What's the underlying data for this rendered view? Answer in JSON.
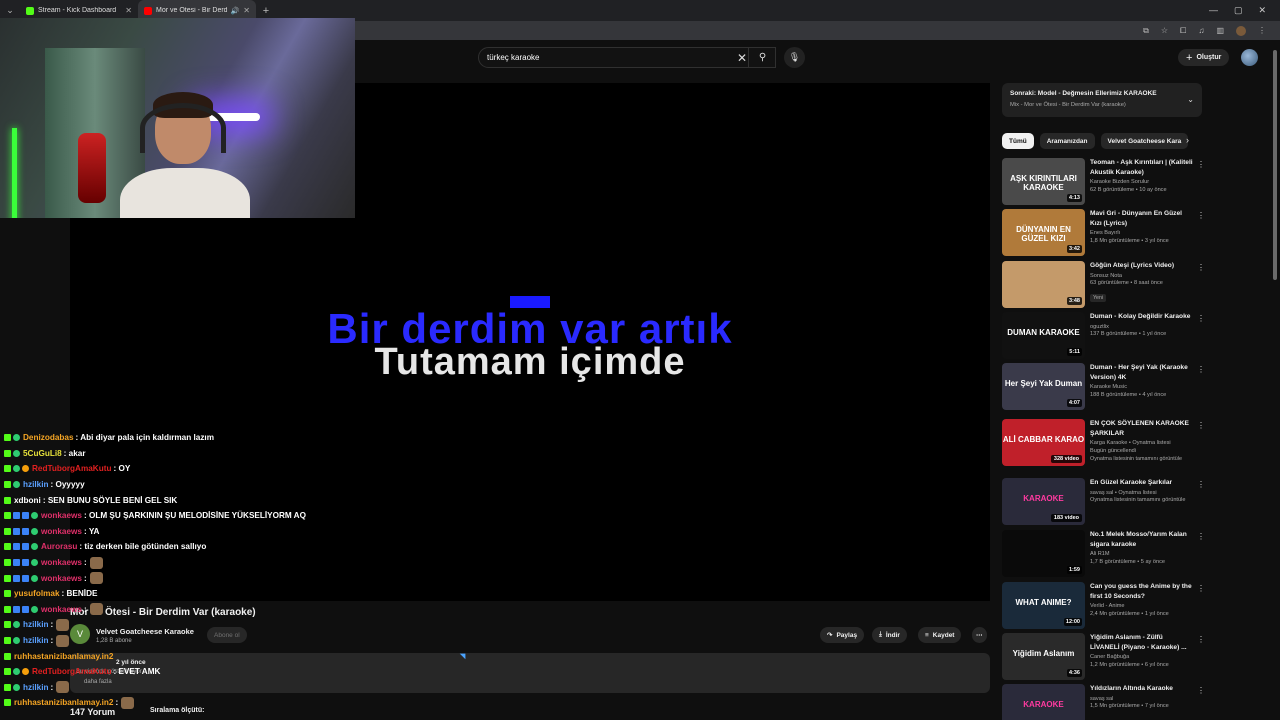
{
  "browser": {
    "tabs": [
      {
        "title": "Stream - Kick Dashboard",
        "active": false,
        "color": "#53fc18"
      },
      {
        "title": "Mor ve Ötesi - Bir Derdim V",
        "active": true,
        "color": "#ff0000"
      }
    ],
    "new_tab": "+"
  },
  "header": {
    "search_value": "türkeç karaoke",
    "create_label": "Oluştur"
  },
  "player": {
    "lyric_line1": "Bir derdim var artık",
    "lyric_line2": "Tutamam içimde"
  },
  "chat": [
    {
      "user": "Denizodabas",
      "user_color": "#f5a524",
      "badges": [
        "k",
        "g"
      ],
      "msg": ": Abi diyar pala için kaldırman lazım"
    },
    {
      "user": "5CuGuLi8",
      "user_color": "#e6e03a",
      "badges": [
        "k",
        "g"
      ],
      "msg": ": akar"
    },
    {
      "user": "RedTuborgAmaKutu",
      "user_color": "#e02020",
      "badges": [
        "k",
        "g",
        "y"
      ],
      "msg": ": OY"
    },
    {
      "user": "hzilkin",
      "user_color": "#5aa0ff",
      "badges": [
        "k",
        "g"
      ],
      "msg": ": Oyyyyy"
    },
    {
      "user": "xdboni",
      "user_color": "#ffffff",
      "badges": [
        "k"
      ],
      "msg": ": SEN BUNU SÖYLE BENİ GEL SIK"
    },
    {
      "user": "wonkaews",
      "user_color": "#e0306a",
      "badges": [
        "k",
        "c",
        "c",
        "g"
      ],
      "msg": ": OLM ŞU ŞARKININ ŞU MELODİSİNE YÜKSELİYORM AQ"
    },
    {
      "user": "wonkaews",
      "user_color": "#e0306a",
      "badges": [
        "k",
        "c",
        "c",
        "g"
      ],
      "msg": ": YA"
    },
    {
      "user": "Aurorasu",
      "user_color": "#e0306a",
      "badges": [
        "k",
        "c",
        "c",
        "g"
      ],
      "msg": ": tiz derken bile götünden sallıyo"
    },
    {
      "user": "wonkaews",
      "user_color": "#e0306a",
      "badges": [
        "k",
        "c",
        "c",
        "g"
      ],
      "msg": ":",
      "emote": true
    },
    {
      "user": "wonkaews",
      "user_color": "#e0306a",
      "badges": [
        "k",
        "c",
        "c",
        "g"
      ],
      "msg": ":",
      "emote": true
    },
    {
      "user": "yusufolmak",
      "user_color": "#f5a524",
      "badges": [
        "k"
      ],
      "msg": ": BENİDE"
    },
    {
      "user": "wonkaews",
      "user_color": "#e0306a",
      "badges": [
        "k",
        "c",
        "c",
        "g"
      ],
      "msg": ":",
      "emote": true
    },
    {
      "user": "hzilkin",
      "user_color": "#5aa0ff",
      "badges": [
        "k",
        "g"
      ],
      "msg": ":",
      "emote": true
    },
    {
      "user": "hzilkin",
      "user_color": "#5aa0ff",
      "badges": [
        "k",
        "g"
      ],
      "msg": ":",
      "emote": true
    },
    {
      "user": "ruhhastanizibanlamay.in2",
      "user_color": "#f5a524",
      "badges": [
        "k"
      ],
      "msg": ""
    },
    {
      "user": "RedTuborgAmaKutu",
      "user_color": "#e02020",
      "badges": [
        "k",
        "g",
        "y"
      ],
      "msg": ": EVET AMK"
    },
    {
      "user": "hzilkin",
      "user_color": "#5aa0ff",
      "badges": [
        "k",
        "g"
      ],
      "msg": ":",
      "emote": true
    },
    {
      "user": "ruhhastanizibanlamay.in2",
      "user_color": "#f5a524",
      "badges": [
        "k"
      ],
      "msg": ":",
      "emote": true
    }
  ],
  "video": {
    "title": "Mor ve Ötesi - Bir Derdim Var (karaoke)",
    "channel": "Velvet Goatcheese Karaoke",
    "channel_initial": "V",
    "subscribers": "1,28 B abone",
    "subscribe_label": "Abone ol",
    "share_label": "Paylaş",
    "download_label": "İndir",
    "save_label": "Kaydet",
    "views": "2 yıl önce",
    "desc1": "Bu videoda gösterilmiyor",
    "desc2": "daha fazla",
    "desc_note": "bulunmuyor değil",
    "comments_count": "147 Yorum",
    "sort_label": "Sıralama ölçütü:"
  },
  "sidebar": {
    "up_next_title": "Sonraki: Model - Değmesin Ellerimiz KARAOKE",
    "up_next_sub": "Mix - Mor ve Ötesi - Bir Derdim Var (karaoke)",
    "chips": [
      "Tümü",
      "Aramanızdan",
      "Velvet Goatcheese Kara"
    ],
    "recs": [
      {
        "title": "Teoman - Aşk Kırıntıları | (Kaliteli Akustik Karaoke)",
        "channel": "Karaoke Bizden Sorulur",
        "views": "62 B görüntüleme • 10 ay önce",
        "duration": "4:13",
        "thumb_text": "AŞK KIRINTILARI KARAOKE",
        "bg": "#4a4a4a",
        "fg": "#ffffff"
      },
      {
        "title": "Mavi Gri - Dünyanın En Güzel Kızı (Lyrics)",
        "channel": "Enes Bayırlı",
        "views": "1,8 Mn görüntüleme • 3 yıl önce",
        "duration": "3:42",
        "thumb_text": "DÜNYANIN EN GÜZEL KIZI",
        "bg": "#b07a3a",
        "fg": "#ffffff"
      },
      {
        "title": "Göğün Ateşi (Lyrics Video)",
        "channel": "Sonsuz Nota",
        "views": "63 görüntüleme • 8 saat önce",
        "duration": "3:48",
        "badge": "Yeni",
        "thumb_text": "",
        "bg": "#c49a6a",
        "fg": "#ffffff"
      },
      {
        "title": "Duman - Kolay Değildir Karaoke",
        "channel": "oguztlix",
        "views": "137 B görüntüleme • 1 yıl önce",
        "duration": "5:11",
        "thumb_text": "DUMAN KARAOKE",
        "bg": "#111111",
        "fg": "#ffffff"
      },
      {
        "title": "Duman - Her Şeyi Yak (Karaoke Version) 4K",
        "channel": "Karaoke Music",
        "views": "188 B görüntüleme • 4 yıl önce",
        "duration": "4:07",
        "thumb_text": "Her Şeyi Yak Duman",
        "bg": "#3a3a4a",
        "fg": "#ffffff"
      },
      {
        "title": "EN ÇOK SÖYLENEN KARAOKE ŞARKILAR",
        "channel": "Karga Karaoke • Oynatma listesi",
        "views": "Bugün güncellendi",
        "extra": "Oynatma listesinin tamamını görüntüle",
        "count": "328 video",
        "thumb_text": "ALİ CABBAR KARAO",
        "bg": "#c0202a",
        "fg": "#ffffff"
      },
      {
        "title": "En Güzel Karaoke Şarkılar",
        "channel": "savaş sal • Oynatma listesi",
        "views": "Oynatma listesinin tamamını görüntüle",
        "count": "183 video",
        "thumb_text": "KARAOKE",
        "bg": "#2a2a3a",
        "fg": "#ff3aa0"
      },
      {
        "title": "No.1 Melek Mosso/Yarım Kalan sigara karaoke",
        "channel": "Ali R1M",
        "views": "1,7 B görüntüleme • 5 ay önce",
        "duration": "1:59",
        "thumb_text": "",
        "bg": "#0a0a0a",
        "fg": "#dddddd"
      },
      {
        "title": "Can you guess the Anime by the first 10 Seconds?",
        "channel": "Verlid - Anime",
        "views": "2,4 Mn görüntüleme • 1 yıl önce",
        "duration": "12:00",
        "thumb_text": "WHAT ANIME?",
        "bg": "#1a2a3a",
        "fg": "#ffffff"
      },
      {
        "title": "Yiğidim Aslanım - Zülfü LİVANELİ (Piyano - Karaoke) ...",
        "channel": "Caner Bağbuğa",
        "views": "1,2 Mn görüntüleme • 6 yıl önce",
        "duration": "4:36",
        "thumb_text": "Yiğidim Aslanım",
        "bg": "#2a2a2a",
        "fg": "#ffffff"
      },
      {
        "title": "Yıldızların Altında Karaoke",
        "channel": "savaş sal",
        "views": "1,5 Mn görüntüleme • 7 yıl önce",
        "duration": "",
        "thumb_text": "KARAOKE",
        "bg": "#2a2a3a",
        "fg": "#ff3aa0"
      }
    ]
  }
}
